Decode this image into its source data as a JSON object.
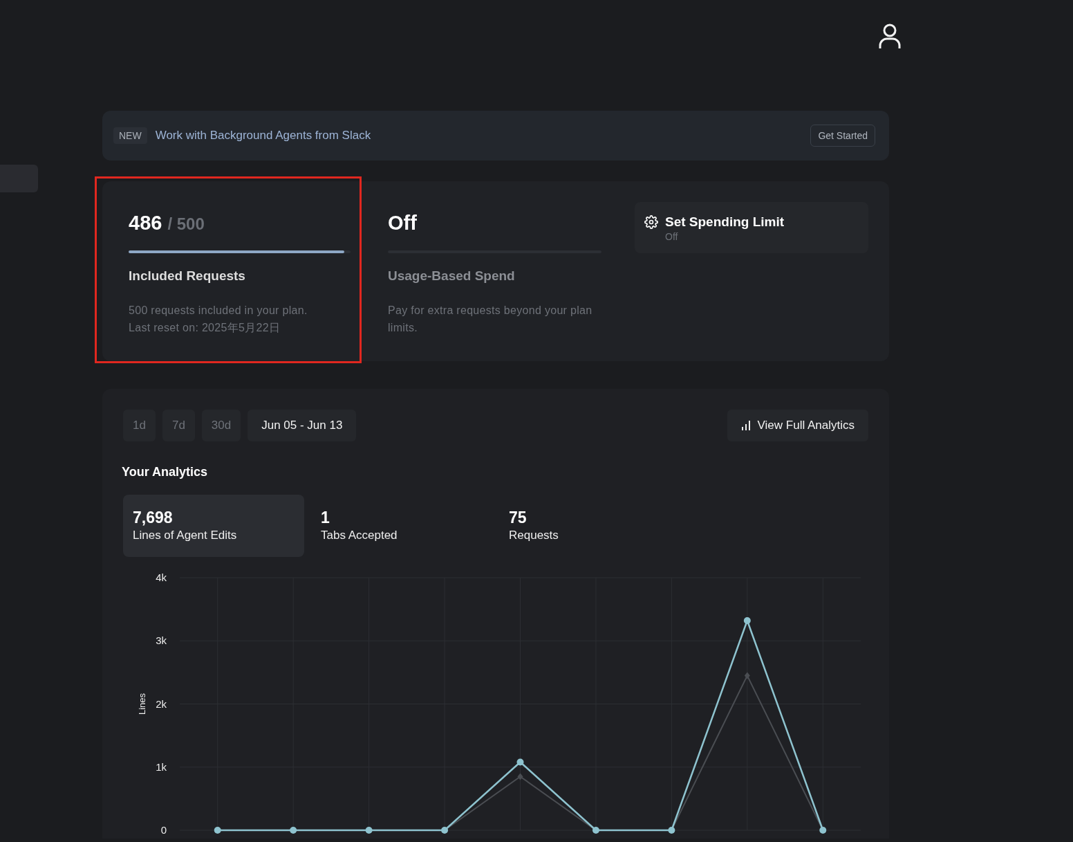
{
  "banner": {
    "badge": "NEW",
    "message": "Work with Background Agents from Slack",
    "action": "Get Started"
  },
  "usage": {
    "meters": [
      {
        "value": "486",
        "total": "/ 500",
        "level": 0.972,
        "title": "Included Requests",
        "description": "500 requests included in your plan.",
        "detail": "Last reset on: 2025年5月22日",
        "active": true,
        "highlighted": true
      },
      {
        "value": "Off",
        "level": 0,
        "title": "Usage-Based Spend",
        "description": "Pay for extra requests beyond your plan limits.",
        "active": false,
        "highlighted": false
      }
    ],
    "spending_button": {
      "label": "Set Spending Limit",
      "status": "Off"
    }
  },
  "analytics": {
    "ranges": [
      {
        "label": "1d",
        "selected": false
      },
      {
        "label": "7d",
        "selected": false
      },
      {
        "label": "30d",
        "selected": false
      },
      {
        "label": "Jun 05 - Jun 13",
        "selected": true
      }
    ],
    "view_button": "View Full Analytics",
    "title": "Your Analytics",
    "stats": [
      {
        "value": "7,698",
        "label": "Lines of Agent Edits",
        "selected": true
      },
      {
        "value": "1",
        "label": "Tabs Accepted",
        "selected": false
      },
      {
        "value": "75",
        "label": "Requests",
        "selected": false
      }
    ],
    "chart_data": {
      "type": "line",
      "ylabel": "Lines",
      "ylim": [
        0,
        4000
      ],
      "grid": true,
      "yticks": [
        {
          "value": 0,
          "label": "0"
        },
        {
          "value": 1000,
          "label": "1k"
        },
        {
          "value": 2000,
          "label": "2k"
        },
        {
          "value": 3000,
          "label": "3k"
        },
        {
          "value": 4000,
          "label": "4k"
        }
      ],
      "series": [
        {
          "color": "#8ec3cf",
          "marker": "circle",
          "values": [
            0,
            0,
            0,
            0,
            1080,
            0,
            0,
            3320,
            0
          ]
        },
        {
          "color": "#4a4d52",
          "marker": "diamond",
          "values": [
            0,
            0,
            0,
            0,
            850,
            0,
            0,
            2450,
            0
          ]
        }
      ]
    }
  }
}
